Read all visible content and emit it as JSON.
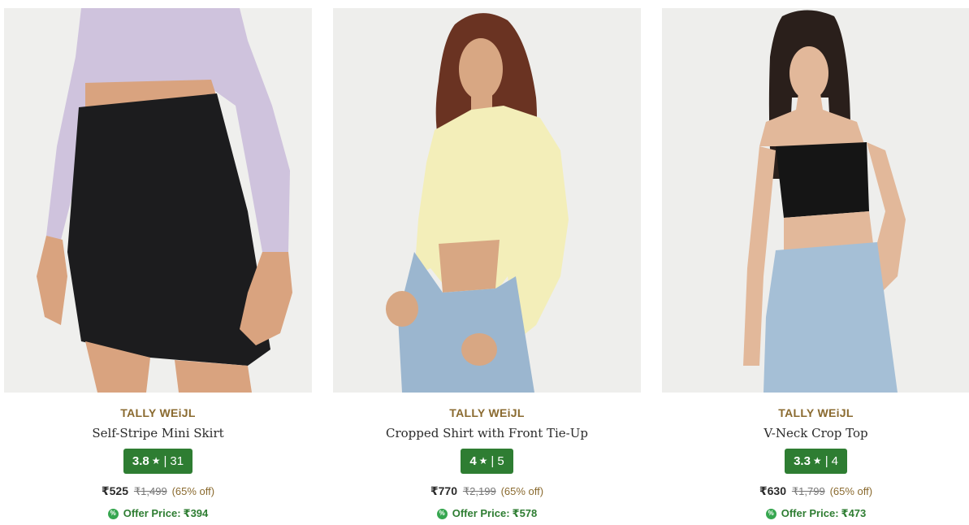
{
  "products": [
    {
      "brand": "TALLY WEiJL",
      "name": "Self-Stripe Mini Skirt",
      "rating": "3.8",
      "rating_star": "★",
      "rating_sep": "|",
      "rating_count": "31",
      "price": "₹525",
      "mrp": "₹1,499",
      "discount": "(65% off)",
      "offer_label": "Offer Price:",
      "offer_price": "₹394",
      "offer_icon": "%",
      "image_colors": {
        "bg": "#efefed",
        "garment": "#1c1c1e",
        "top": "#cfc3dd",
        "skin": "#d9a37f"
      }
    },
    {
      "brand": "TALLY WEiJL",
      "name": "Cropped Shirt with Front Tie-Up",
      "rating": "4",
      "rating_star": "★",
      "rating_sep": "|",
      "rating_count": "5",
      "price": "₹770",
      "mrp": "₹2,199",
      "discount": "(65% off)",
      "offer_label": "Offer Price:",
      "offer_price": "₹578",
      "offer_icon": "%",
      "image_colors": {
        "bg": "#eeeeec",
        "garment": "#f3eeb9",
        "jeans": "#9bb6cf",
        "skin": "#d8a783",
        "hair": "#6a3322"
      }
    },
    {
      "brand": "TALLY WEiJL",
      "name": "V-Neck Crop Top",
      "rating": "3.3",
      "rating_star": "★",
      "rating_sep": "|",
      "rating_count": "4",
      "price": "₹630",
      "mrp": "₹1,799",
      "discount": "(65% off)",
      "offer_label": "Offer Price:",
      "offer_price": "₹473",
      "offer_icon": "%",
      "image_colors": {
        "bg": "#eeeeec",
        "garment": "#151515",
        "jeans": "#a5bfd6",
        "skin": "#e2b89a",
        "hair": "#2a1f1b"
      }
    }
  ],
  "colors": {
    "brand": "#8a6a2f",
    "rating_badge": "#2e7d32",
    "offer": "#2e7d32"
  }
}
